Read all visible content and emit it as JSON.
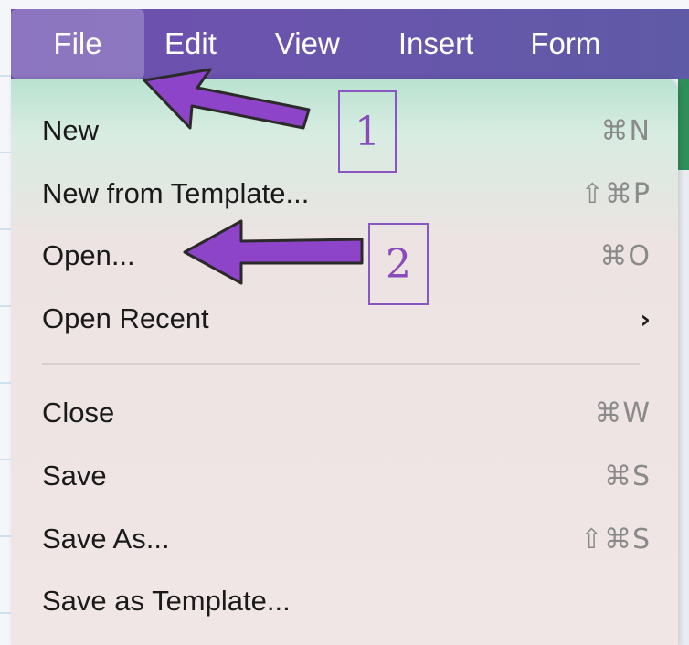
{
  "menubar": {
    "items": [
      {
        "label": "File",
        "active": true
      },
      {
        "label": "Edit"
      },
      {
        "label": "View"
      },
      {
        "label": "Insert"
      },
      {
        "label": "Form"
      }
    ]
  },
  "file_menu": {
    "items": [
      {
        "label": "New",
        "shortcut": "⌘N"
      },
      {
        "label": "New from Template...",
        "shortcut": "⇧⌘P"
      },
      {
        "label": "Open...",
        "shortcut": "⌘O"
      },
      {
        "label": "Open Recent",
        "submenu": "›"
      },
      {
        "label": "Close",
        "shortcut": "⌘W"
      },
      {
        "label": "Save",
        "shortcut": "⌘S"
      },
      {
        "label": "Save As...",
        "shortcut": "⇧⌘S"
      },
      {
        "label": "Save as Template..."
      }
    ]
  },
  "annotations": {
    "step1": "1",
    "step2": "2",
    "arrow_color": "#8e44c9"
  }
}
